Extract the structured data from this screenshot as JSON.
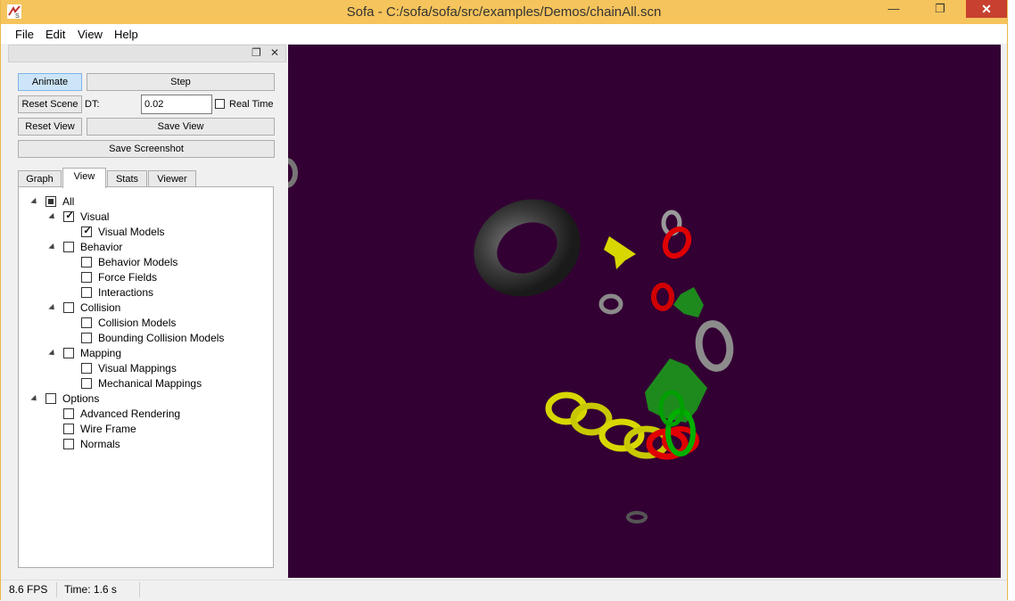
{
  "window": {
    "title": "Sofa - C:/sofa/sofa/src/examples/Demos/chainAll.scn",
    "minimize_glyph": "—",
    "restore_glyph": "❐",
    "close_glyph": "✕",
    "titlebar_color": "#f6c45c",
    "close_color": "#c8402f"
  },
  "menu": {
    "items": [
      "File",
      "Edit",
      "View",
      "Help"
    ]
  },
  "dock": {
    "float_glyph": "❐",
    "close_glyph": "✕"
  },
  "controls": {
    "animate_label": "Animate",
    "step_label": "Step",
    "reset_scene_label": "Reset Scene",
    "dt_label": "DT:",
    "dt_value": "0.02",
    "real_time_label": "Real Time",
    "reset_view_label": "Reset View",
    "save_view_label": "Save View",
    "save_screenshot_label": "Save Screenshot"
  },
  "tabs": {
    "items": [
      "Graph",
      "View",
      "Stats",
      "Viewer"
    ],
    "selected": "View"
  },
  "tree": {
    "items": [
      {
        "label": "All",
        "state": "partial"
      },
      {
        "label": "Visual",
        "state": "checked"
      },
      {
        "label": "Visual Models",
        "state": "checked"
      },
      {
        "label": "Behavior",
        "state": "unchecked"
      },
      {
        "label": "Behavior Models",
        "state": "unchecked"
      },
      {
        "label": "Force Fields",
        "state": "unchecked"
      },
      {
        "label": "Interactions",
        "state": "unchecked"
      },
      {
        "label": "Collision",
        "state": "unchecked"
      },
      {
        "label": "Collision Models",
        "state": "unchecked"
      },
      {
        "label": "Bounding Collision Models",
        "state": "unchecked"
      },
      {
        "label": "Mapping",
        "state": "unchecked"
      },
      {
        "label": "Visual Mappings",
        "state": "unchecked"
      },
      {
        "label": "Mechanical Mappings",
        "state": "unchecked"
      },
      {
        "label": "Options",
        "state": "unchecked"
      },
      {
        "label": "Advanced Rendering",
        "state": "unchecked"
      },
      {
        "label": "Wire Frame",
        "state": "unchecked"
      },
      {
        "label": "Normals",
        "state": "unchecked"
      }
    ]
  },
  "viewport": {
    "background": "#330033"
  },
  "status": {
    "fps": "8.6 FPS",
    "time": "Time: 1.6 s"
  }
}
